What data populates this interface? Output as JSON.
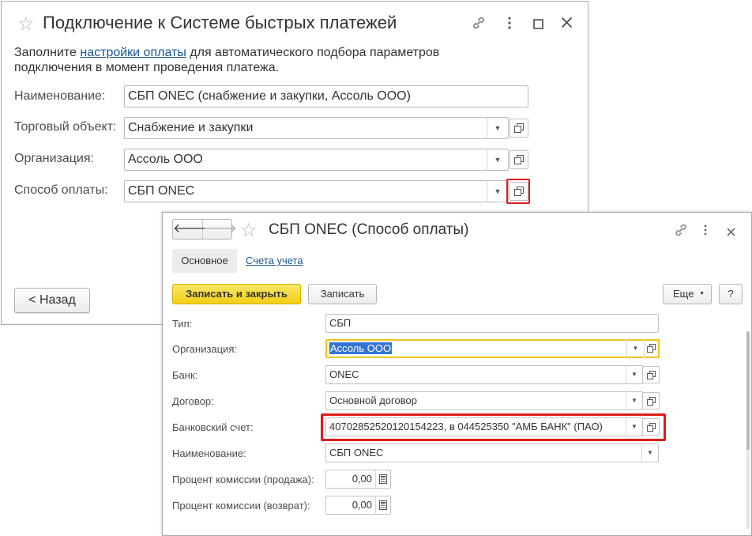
{
  "window1": {
    "title": "Подключение к Системе быстрых платежей",
    "intro_prefix": "Заполните ",
    "intro_link": "настройки оплаты",
    "intro_suffix": " для автоматического подбора параметров подключения в момент проведения платежа.",
    "fields": {
      "name": {
        "label": "Наименование:",
        "value": "СБП ONEC (снабжение и закупки, Ассоль ООО)"
      },
      "trade_object": {
        "label": "Торговый объект:",
        "value": "Снабжение и закупки"
      },
      "organization": {
        "label": "Организация:",
        "value": "Ассоль ООО"
      },
      "payment_method": {
        "label": "Способ оплаты:",
        "value": "СБП ONEC"
      }
    },
    "back_button": "< Назад"
  },
  "window2": {
    "title": "СБП ONEC (Способ оплаты)",
    "nav": {
      "back": "🡐",
      "forward": "🡒"
    },
    "tabs": [
      "Основное",
      "Счета учета"
    ],
    "buttons": {
      "save_close": "Записать и закрыть",
      "save": "Записать",
      "more": "Еще",
      "help": "?"
    },
    "fields": {
      "type": {
        "label": "Тип:",
        "value": "СБП"
      },
      "organization": {
        "label": "Организация:",
        "value": "Ассоль ООО"
      },
      "bank": {
        "label": "Банк:",
        "value": "ONEC"
      },
      "contract": {
        "label": "Договор:",
        "value": "Основной договор"
      },
      "bank_account": {
        "label": "Банковский счет:",
        "value": "40702852520120154223, в 044525350 \"АМБ БАНК\" (ПАО)"
      },
      "name": {
        "label": "Наименование:",
        "value": "СБП ONEC"
      },
      "commission_sale": {
        "label": "Процент комиссии (продажа):",
        "value": "0,00"
      },
      "commission_return": {
        "label": "Процент комиссии (возврат):",
        "value": "0,00"
      }
    }
  },
  "colors": {
    "highlight_red": "#e11a1a",
    "primary_button": "#f3cf14",
    "focus_border": "#f0c419",
    "link": "#1a5596",
    "selection": "#3574d4"
  }
}
